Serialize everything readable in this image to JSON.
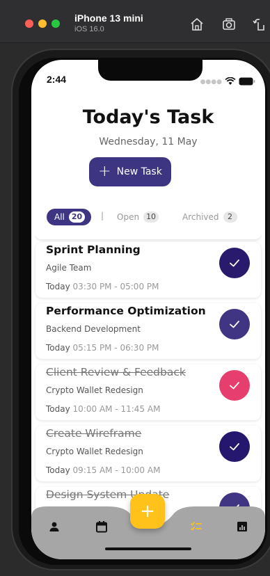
{
  "simulator": {
    "device_name": "iPhone 13 mini",
    "os_version": "iOS 16.0",
    "icons": [
      "home-icon",
      "screenshot-icon",
      "rotate-icon"
    ]
  },
  "status_bar": {
    "time": "2:44"
  },
  "header": {
    "title": "Today's Task",
    "date": "Wednesday, 11 May",
    "new_task_label": "New Task"
  },
  "tabs": {
    "all": {
      "label": "All",
      "count": "20"
    },
    "separator": "|",
    "open": {
      "label": "Open",
      "count": "10"
    },
    "archived": {
      "label": "Archived",
      "count": "2"
    }
  },
  "tasks": [
    {
      "title": "Sprint Planning",
      "subtitle": "Agile Team",
      "day": "Today",
      "time": "03:30 PM - 05:00 PM",
      "done": false,
      "check_color": "#2a1a6e"
    },
    {
      "title": "Performance Optimization",
      "subtitle": "Backend Development",
      "day": "Today",
      "time": "05:15 PM - 06:30 PM",
      "done": false,
      "check_color": "#3f3582"
    },
    {
      "title": "Client Review & Feedback",
      "subtitle": "Crypto Wallet Redesign",
      "day": "Today",
      "time": "10:00 AM - 11:45 AM",
      "done": true,
      "check_color": "#e63e6d"
    },
    {
      "title": "Create Wireframe",
      "subtitle": "Crypto Wallet Redesign",
      "day": "Today",
      "time": "09:15 AM - 10:00 AM",
      "done": true,
      "check_color": "#25166e"
    },
    {
      "title": "Design System Update",
      "subtitle": "",
      "day": "",
      "time": "",
      "done": true,
      "check_color": "#3f3582"
    }
  ],
  "nav": {
    "items": [
      "person-icon",
      "calendar-icon",
      "add-icon",
      "tasks-icon",
      "stats-icon"
    ],
    "fab_label": "+",
    "active_color": "#ffc21a",
    "bar_color": "#a6a6a6"
  },
  "colors": {
    "accent": "#3d3582",
    "fab": "#ffc21a"
  }
}
